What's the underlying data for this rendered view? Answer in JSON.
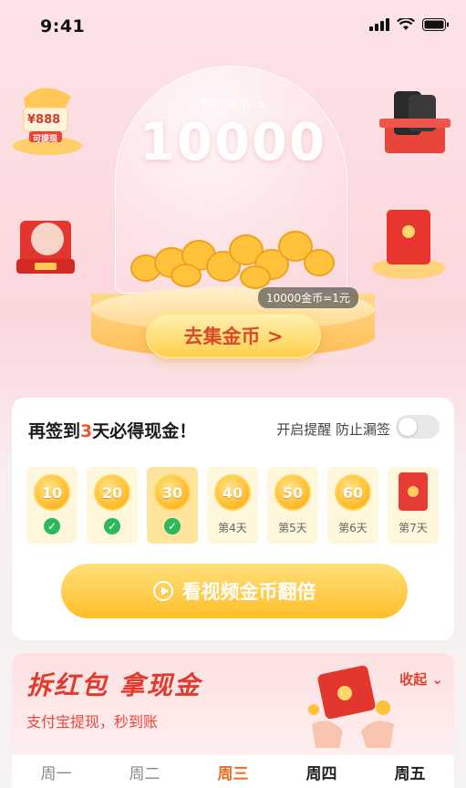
{
  "status": {
    "time": "9:41"
  },
  "hero": {
    "my_coins_label": "我的金币 >",
    "coins_value": "10000",
    "rate_tip": "10000金币=1元",
    "collect_button": "去集金币 >",
    "corner_top_left_text": "¥888",
    "corner_top_left_sub": "可提现"
  },
  "signin": {
    "title_prefix": "再签到",
    "title_days": "3",
    "title_suffix": "天必得现金！",
    "reminder_label": "开启提醒 防止漏签",
    "reminder_on": false,
    "days": [
      {
        "coins": "10",
        "status": "checked",
        "label": ""
      },
      {
        "coins": "20",
        "status": "checked",
        "label": ""
      },
      {
        "coins": "30",
        "status": "checked",
        "label": ""
      },
      {
        "coins": "40",
        "status": "pending",
        "label": "第4天"
      },
      {
        "coins": "50",
        "status": "pending",
        "label": "第5天"
      },
      {
        "coins": "60",
        "status": "pending",
        "label": "第6天"
      },
      {
        "coins": "",
        "status": "envelope",
        "label": "第7天"
      }
    ],
    "video_button": "看视频金币翻倍"
  },
  "redpack": {
    "title": "拆红包  拿现金",
    "subtitle": "支付宝提现，秒到账",
    "collapse_label": "收起",
    "weekdays": [
      "周一",
      "周二",
      "周三",
      "周四",
      "周五"
    ],
    "active_weekday": 2
  },
  "colors": {
    "accent": "#f2542d",
    "gold": "#ffbe2a",
    "red": "#e23a2f"
  }
}
